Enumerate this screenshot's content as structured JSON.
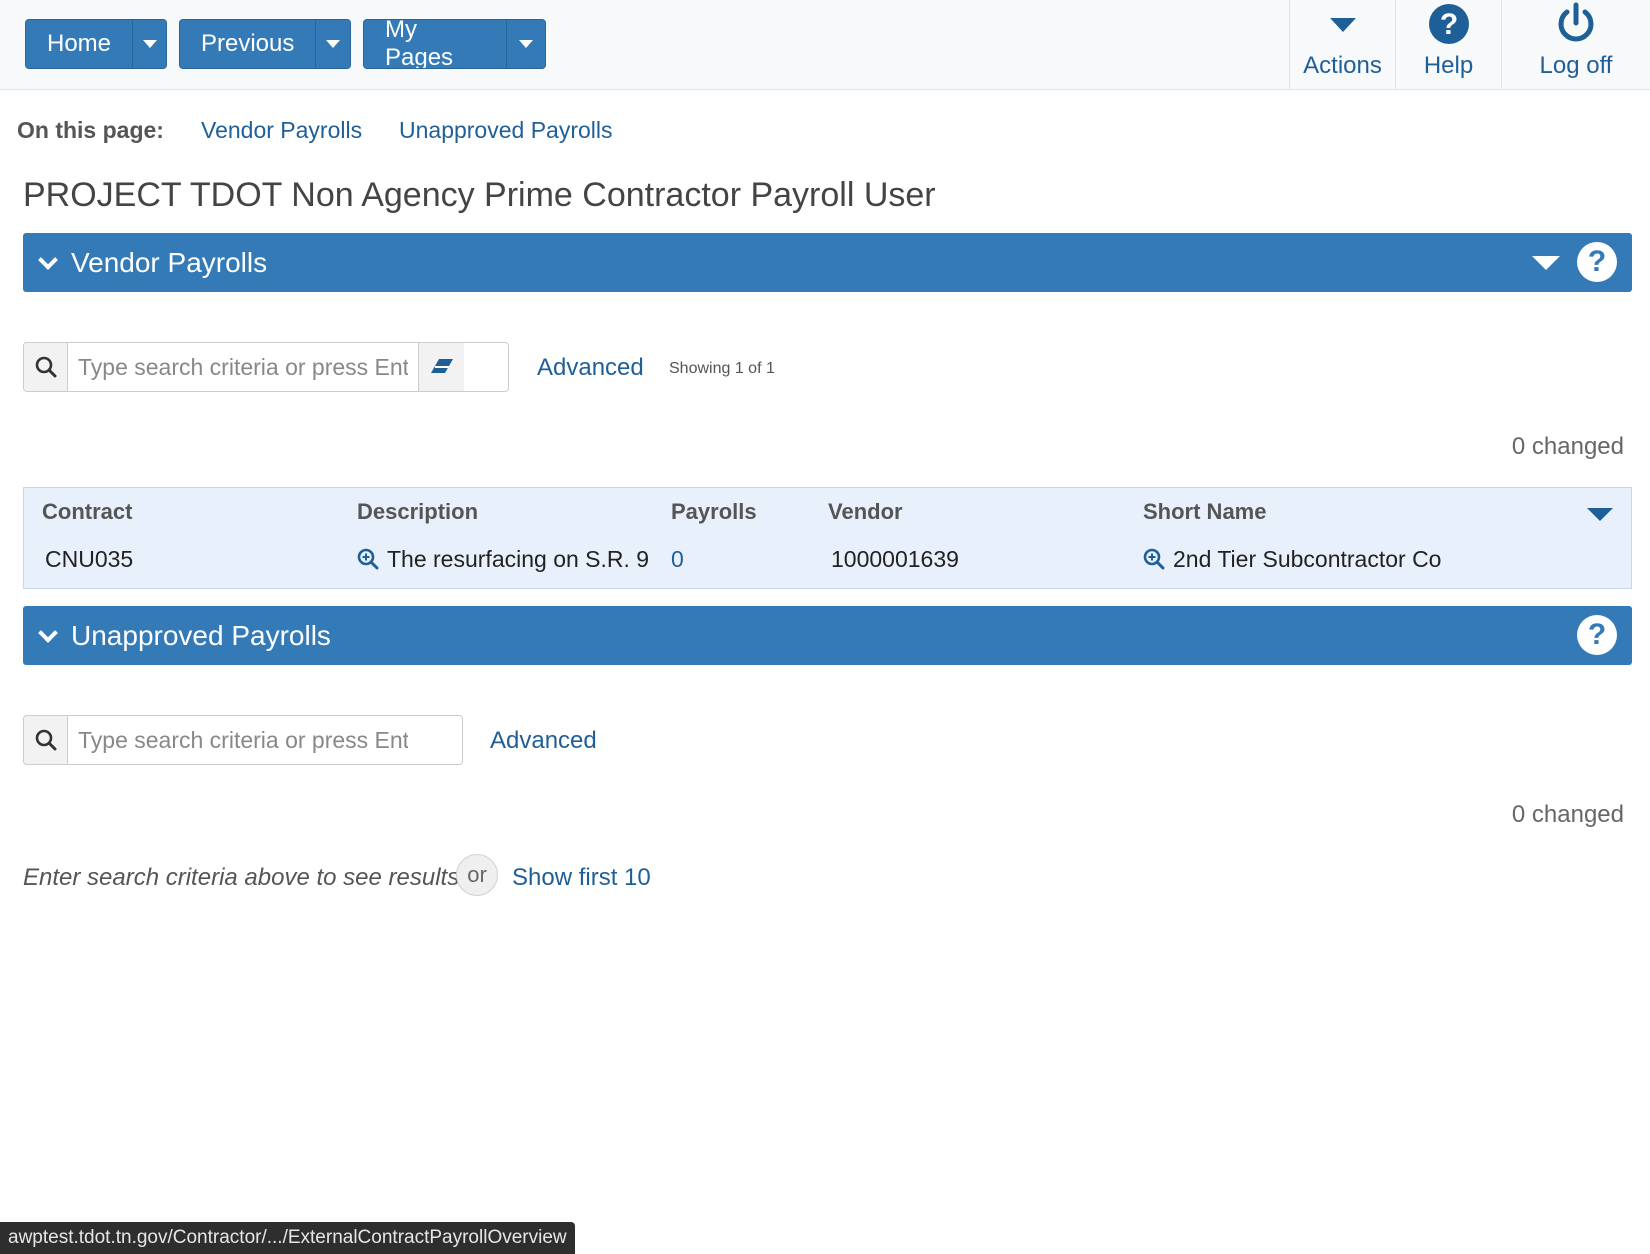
{
  "nav": {
    "home": "Home",
    "previous": "Previous",
    "my_pages": "My Pages",
    "actions": "Actions",
    "help": "Help",
    "logoff": "Log off"
  },
  "on_this_page": {
    "label": "On this page:",
    "links": [
      "Vendor Payrolls",
      "Unapproved Payrolls"
    ]
  },
  "page_title": "PROJECT TDOT Non Agency Prime Contractor Payroll User",
  "vendor_panel": {
    "title": "Vendor Payrolls",
    "search_placeholder": "Type search criteria or press Enter",
    "advanced": "Advanced",
    "showing": "Showing 1 of 1",
    "changed": "0 changed",
    "columns": [
      "Contract",
      "Description",
      "Payrolls",
      "Vendor",
      "Short Name"
    ],
    "rows": [
      {
        "contract": "CNU035",
        "description": "The resurfacing on S.R. 9",
        "payrolls": "0",
        "vendor": "1000001639",
        "short_name": "2nd Tier Subcontractor Co"
      }
    ]
  },
  "unapproved_panel": {
    "title": "Unapproved Payrolls",
    "search_placeholder": "Type search criteria or press Enter",
    "advanced": "Advanced",
    "changed": "0 changed",
    "hint": "Enter search criteria above to see results",
    "or": "or",
    "show_first": "Show first 10"
  },
  "status_url": "awptest.tdot.tn.gov/Contractor/.../ExternalContractPayrollOverview",
  "colors": {
    "primary": "#337ab7",
    "link": "#1f5f98"
  }
}
